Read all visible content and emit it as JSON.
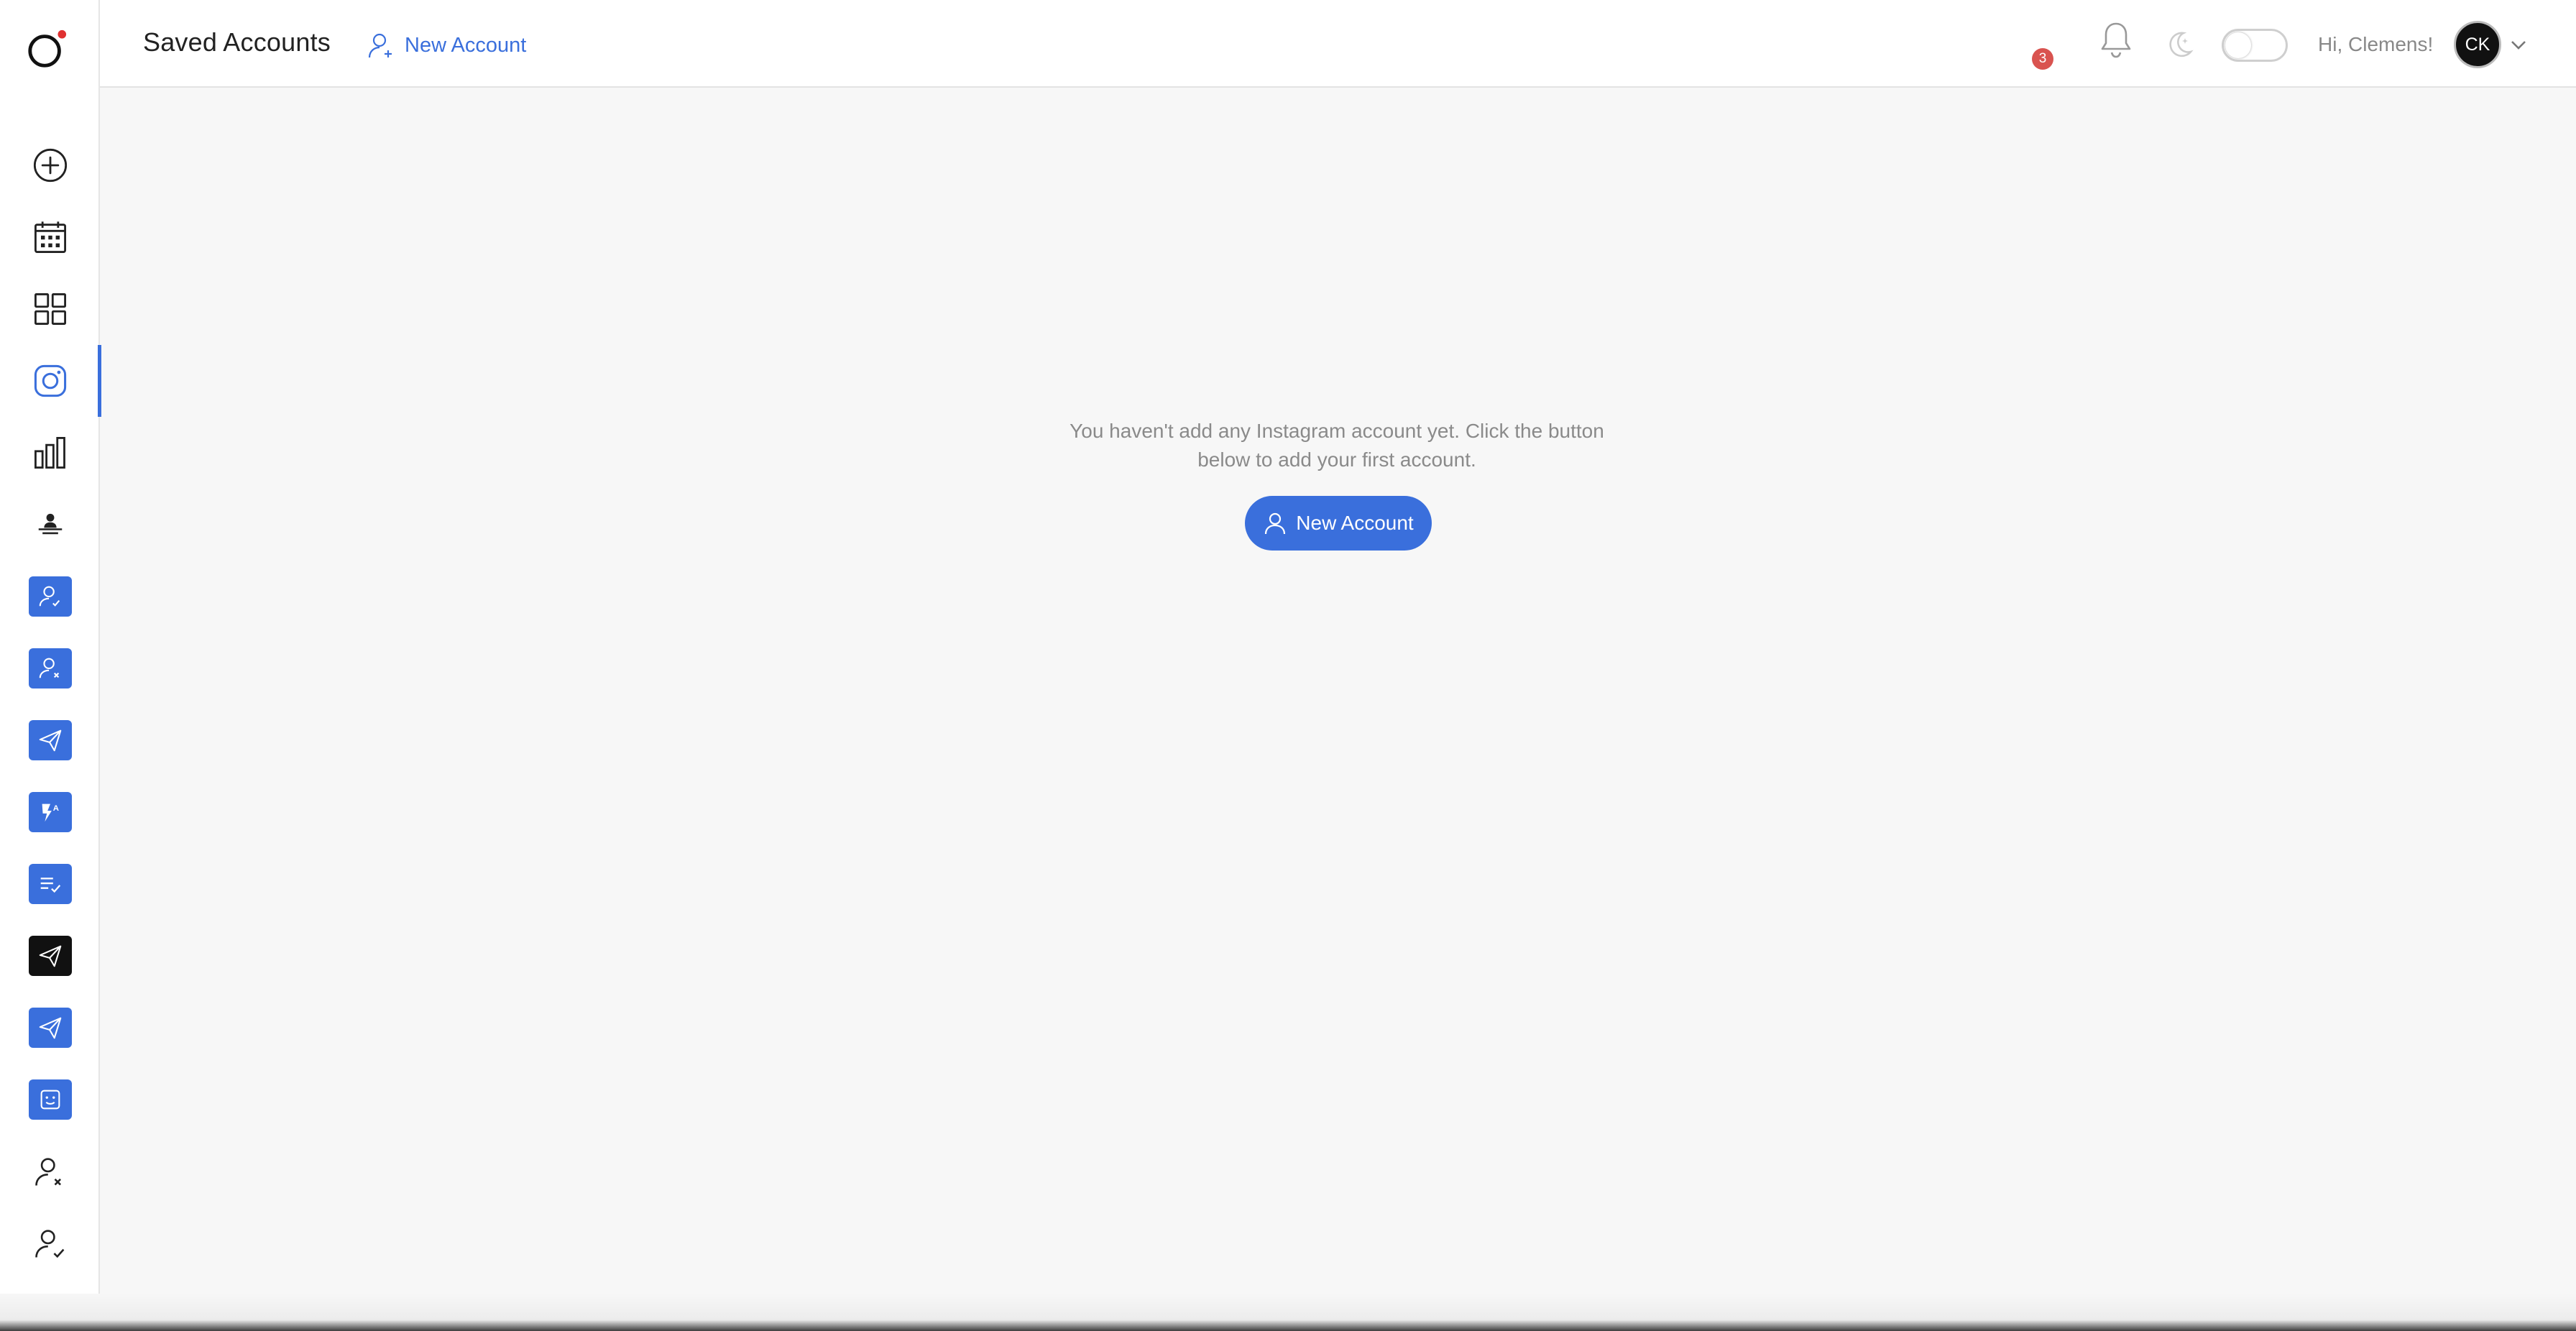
{
  "header": {
    "title": "Saved Accounts",
    "new_account_link": "New Account",
    "notifications_count": "3",
    "greeting": "Hi, Clemens!",
    "avatar_initials": "CK"
  },
  "main": {
    "empty_message_line1": "You haven't add any Instagram account yet. Click the button",
    "empty_message_line2": "below to add your first account.",
    "new_account_button": "New Account"
  },
  "sidebar": {
    "items": [
      {
        "icon": "add-circle-icon"
      },
      {
        "icon": "calendar-icon"
      },
      {
        "icon": "grid-icon"
      },
      {
        "icon": "instagram-icon",
        "active": true
      },
      {
        "icon": "bar-chart-icon"
      },
      {
        "icon": "person-desk-icon"
      },
      {
        "icon": "user-check-tile-icon"
      },
      {
        "icon": "user-remove-tile-icon"
      },
      {
        "icon": "send-tile-icon"
      },
      {
        "icon": "flash-auto-tile-icon"
      },
      {
        "icon": "list-check-tile-icon"
      },
      {
        "icon": "send-black-tile-icon"
      },
      {
        "icon": "send-tile-icon"
      },
      {
        "icon": "sticker-tile-icon"
      },
      {
        "icon": "user-x-icon"
      },
      {
        "icon": "user-check-icon"
      }
    ]
  },
  "colors": {
    "accent": "#3a6fdc",
    "badge": "#d9534f",
    "background": "#f7f7f7"
  }
}
